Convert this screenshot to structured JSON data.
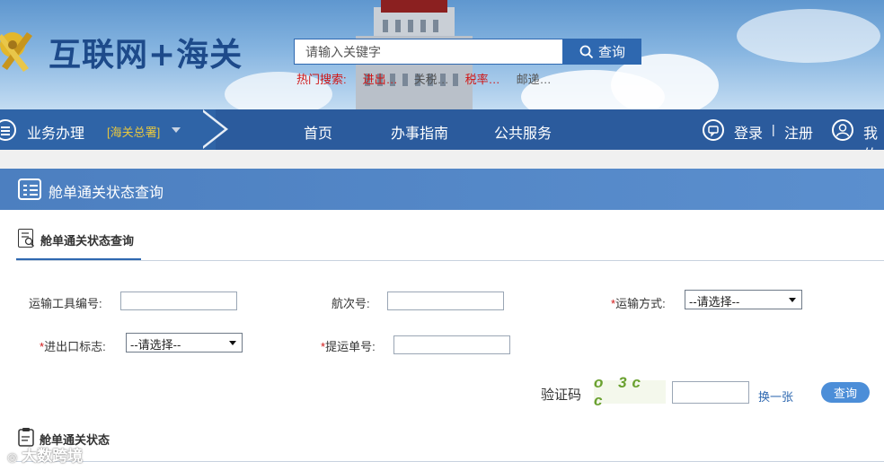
{
  "header": {
    "site_title": "互联网+海关",
    "search_placeholder": "请输入关键字",
    "search_button": "查询",
    "hot_label": "热门搜索:",
    "hot_items": [
      "进出…",
      "关税…",
      "税率…",
      "邮递…"
    ],
    "hot_colors": [
      "#d01616",
      "#d01616",
      "#555555",
      "#d01616",
      "#555555"
    ]
  },
  "nav": {
    "business": "业务办理",
    "hq": "[海关总署]",
    "items": [
      "首页",
      "办事指南",
      "公共服务"
    ],
    "login": "登录",
    "separator": "|",
    "register": "注册",
    "mine": "我的"
  },
  "section": {
    "title": "舱单通关状态查询"
  },
  "tab": {
    "title": "舱单通关状态查询"
  },
  "form": {
    "vehicle_no_label": "运输工具编号:",
    "voyage_label": "航次号:",
    "transport_mode_label": "运输方式:",
    "transport_mode_value": "--请选择--",
    "ie_flag_label": "进出口标志:",
    "ie_flag_value": "--请选择--",
    "bill_no_label": "提运单号:",
    "required_mark": "*",
    "captcha_label": "验证码",
    "captcha_text": "o 3c c",
    "refresh_captcha": "换一张",
    "query_button": "查询"
  },
  "result": {
    "title": "舱单通关状态"
  },
  "watermark": "大数跨境",
  "colors": {
    "brand_blue": "#2b5b9d",
    "section_blue": "#4c7fc0",
    "required_red": "#d01616",
    "hq_yellow": "#e6c640"
  }
}
